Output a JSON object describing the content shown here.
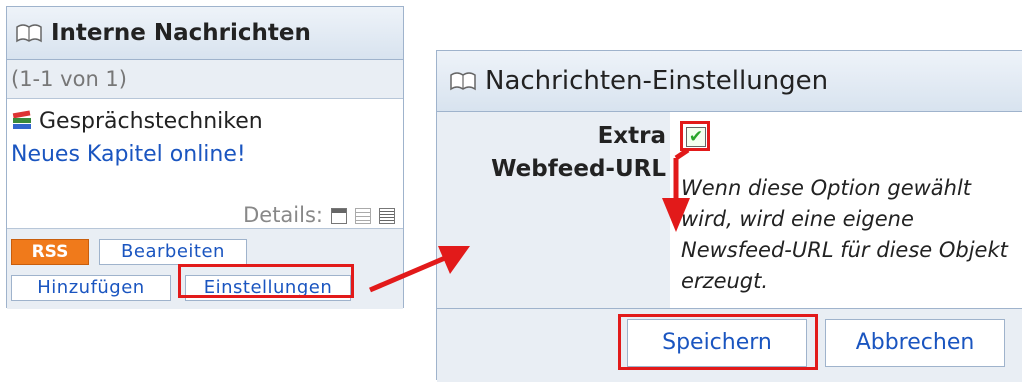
{
  "left_panel": {
    "title": "Interne Nachrichten",
    "count": "(1-1 von 1)",
    "item_title": "Gesprächstechniken",
    "item_link": "Neues Kapitel online!",
    "details_label": "Details:",
    "rss_label": "RSS",
    "edit_label": "Bearbeiten",
    "add_label": "Hinzufügen",
    "settings_label": "Einstellungen"
  },
  "right_panel": {
    "title": "Nachrichten-Einstellungen",
    "option_label_1": "Extra",
    "option_label_2": "Webfeed-URL",
    "option_checked": true,
    "checkmark": "✔",
    "description": "Wenn diese Option gewählt wird, wird eine eigene Newsfeed-URL für diese Objekt erzeugt.",
    "save_label": "Speichern",
    "cancel_label": "Abbrechen"
  },
  "colors": {
    "highlight": "#e21a1a",
    "link": "#1a55c0",
    "header_bg": "#d8e3ef",
    "rss": "#f07a1b"
  }
}
